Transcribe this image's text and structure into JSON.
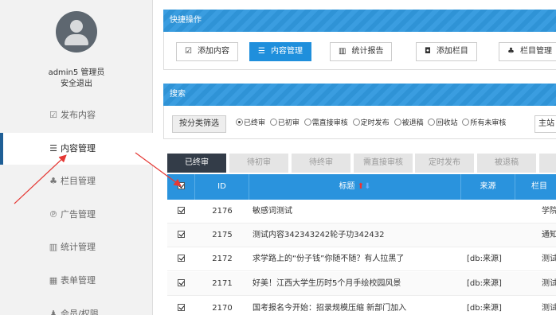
{
  "sidebar": {
    "username": "admin5 管理员",
    "logout": "安全退出",
    "items": [
      {
        "icon": "☑",
        "label": "发布内容"
      },
      {
        "icon": "☰",
        "label": "内容管理"
      },
      {
        "icon": "♣",
        "label": "栏目管理"
      },
      {
        "icon": "℗",
        "label": "广告管理"
      },
      {
        "icon": "▥",
        "label": "统计管理"
      },
      {
        "icon": "▦",
        "label": "表单管理"
      },
      {
        "icon": "♟",
        "label": "会员/权限"
      }
    ]
  },
  "quick": {
    "title": "快捷操作",
    "buttons": [
      {
        "icon": "☑",
        "label": "添加内容"
      },
      {
        "icon": "☰",
        "label": "内容管理"
      },
      {
        "icon": "▥",
        "label": "统计报告"
      },
      {
        "icon": "◘",
        "label": "添加栏目"
      },
      {
        "icon": "♣",
        "label": "栏目管理"
      }
    ]
  },
  "search": {
    "title": "搜索",
    "filter_button": "按分类筛选",
    "options": [
      "已终审",
      "已初审",
      "需直接审核",
      "定时发布",
      "被退稿",
      "回收站",
      "所有未审核"
    ],
    "site": "主站"
  },
  "tabs": [
    "已终审",
    "待初审",
    "待终审",
    "需直接审核",
    "定时发布",
    "被退稿",
    ""
  ],
  "table": {
    "headers": {
      "id": "ID",
      "title": "标题",
      "source": "来源",
      "column": "栏目"
    },
    "rows": [
      {
        "id": "2176",
        "title": "敏感词测试",
        "source": "",
        "column": "学院"
      },
      {
        "id": "2175",
        "title": "测试内容342343242轮子功342432",
        "source": "",
        "column": "通知"
      },
      {
        "id": "2172",
        "title": "求学路上的“份子钱”你随不随？有人拉黑了",
        "source": "[db:来源]",
        "column": "测试"
      },
      {
        "id": "2171",
        "title": "好美！江西大学生历时5个月手绘校园风景",
        "source": "[db:来源]",
        "column": "测试"
      },
      {
        "id": "2170",
        "title": "国考报名今开始：招录规模压缩 新部门加入",
        "source": "[db:来源]",
        "column": "测试"
      }
    ]
  },
  "colors": {
    "accent": "#2a93dd",
    "sidebar": "#f2f2f2",
    "active_tab": "#333c48",
    "annotation": "#e53935"
  }
}
